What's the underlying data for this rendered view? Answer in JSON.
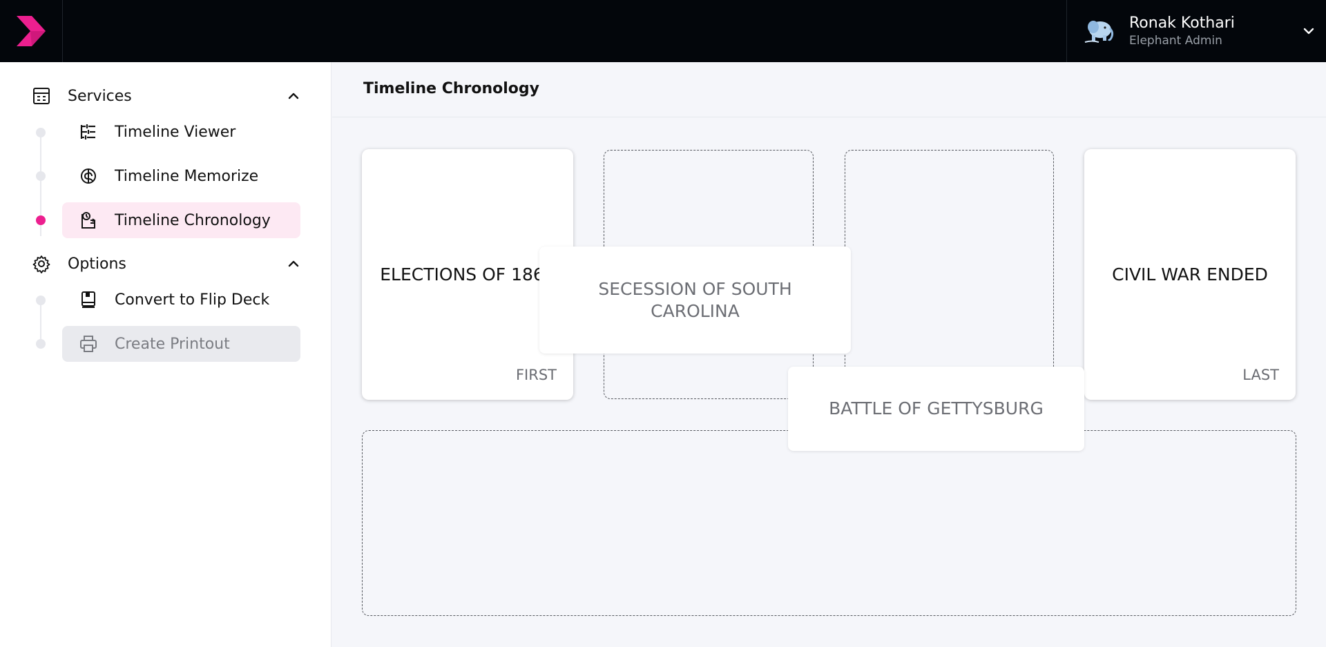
{
  "header": {
    "user": {
      "name": "Ronak Kothari",
      "role": "Elephant Admin",
      "avatar_icon": "elephant-avatar-icon"
    },
    "brand_color": "#ec1f8f"
  },
  "sidebar": {
    "groups": [
      {
        "label": "Services",
        "icon": "calculator-grid-icon",
        "expanded": true,
        "items": [
          {
            "label": "Timeline Viewer",
            "icon": "sliders-list-icon",
            "active": false
          },
          {
            "label": "Timeline Memorize",
            "icon": "brain-icon",
            "active": false
          },
          {
            "label": "Timeline Chronology",
            "icon": "clock-clipboard-icon",
            "active": true
          }
        ]
      },
      {
        "label": "Options",
        "icon": "gear-icon",
        "expanded": true,
        "items": [
          {
            "label": "Convert to Flip Deck",
            "icon": "book-icon",
            "active": false
          },
          {
            "label": "Create Printout",
            "icon": "printer-icon",
            "active": false,
            "disabled": true
          }
        ]
      }
    ]
  },
  "main": {
    "title": "Timeline Chronology",
    "cards": {
      "first": {
        "text": "ELECTIONS OF 1860",
        "tag": "FIRST"
      },
      "last": {
        "text": "CIVIL WAR ENDED",
        "tag": "LAST"
      }
    },
    "draggable_cards": [
      {
        "text": "SECESSION OF SOUTH CAROLINA"
      },
      {
        "text": "BATTLE OF GETTYSBURG"
      }
    ]
  }
}
